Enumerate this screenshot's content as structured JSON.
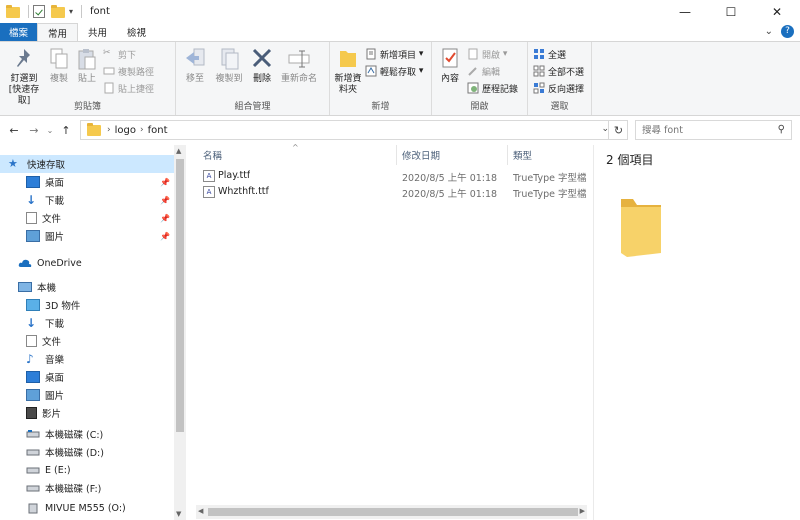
{
  "window": {
    "title": "font",
    "controls": {
      "minimize": "—",
      "maximize": "☐",
      "close": "✕"
    }
  },
  "ribbon_tabs": [
    "檔案",
    "常用",
    "共用",
    "檢視"
  ],
  "ribbon": {
    "clipboard": {
      "label": "剪貼簿",
      "pin": "釘選到 [快速存取]",
      "copy": "複製",
      "paste": "貼上",
      "cut": "剪下",
      "copy_path": "複製路徑",
      "paste_shortcut": "貼上捷徑"
    },
    "organize": {
      "label": "組合管理",
      "move_to": "移至",
      "copy_to": "複製到",
      "delete": "刪除",
      "rename": "重新命名"
    },
    "new": {
      "label": "新增",
      "new_folder": "新增資料夾",
      "new_item": "新增項目",
      "easy_access": "輕鬆存取"
    },
    "open": {
      "label": "開啟",
      "properties": "內容",
      "open": "開啟",
      "edit": "編輯",
      "history": "歷程記錄"
    },
    "select": {
      "label": "選取",
      "select_all": "全選",
      "select_none": "全部不選",
      "invert": "反向選擇"
    }
  },
  "address": {
    "crumbs": [
      "logo",
      "font"
    ],
    "search_placeholder": "搜尋 font"
  },
  "nav": {
    "quick_access": "快速存取",
    "qa_items": [
      "桌面",
      "下載",
      "文件",
      "圖片"
    ],
    "onedrive": "OneDrive",
    "this_pc": "本機",
    "pc_items": [
      "3D 物件",
      "下載",
      "文件",
      "音樂",
      "桌面",
      "圖片",
      "影片"
    ],
    "drives": [
      "本機磁碟 (C:)",
      "本機磁碟 (D:)",
      "E (E:)",
      "本機磁碟 (F:)",
      "MIVUE M555 (O:)"
    ]
  },
  "columns": {
    "name": "名稱",
    "date": "修改日期",
    "type": "類型"
  },
  "files": [
    {
      "name": "Play.ttf",
      "date": "2020/8/5 上午 01:18",
      "type": "TrueType 字型檔案"
    },
    {
      "name": "Whzthft.ttf",
      "date": "2020/8/5 上午 01:18",
      "type": "TrueType 字型檔案"
    }
  ],
  "preview": {
    "count_text": "2 個項目"
  },
  "colors": {
    "accent": "#1a6fbf",
    "folder": "#f5c94d",
    "selection": "#cce8ff"
  }
}
